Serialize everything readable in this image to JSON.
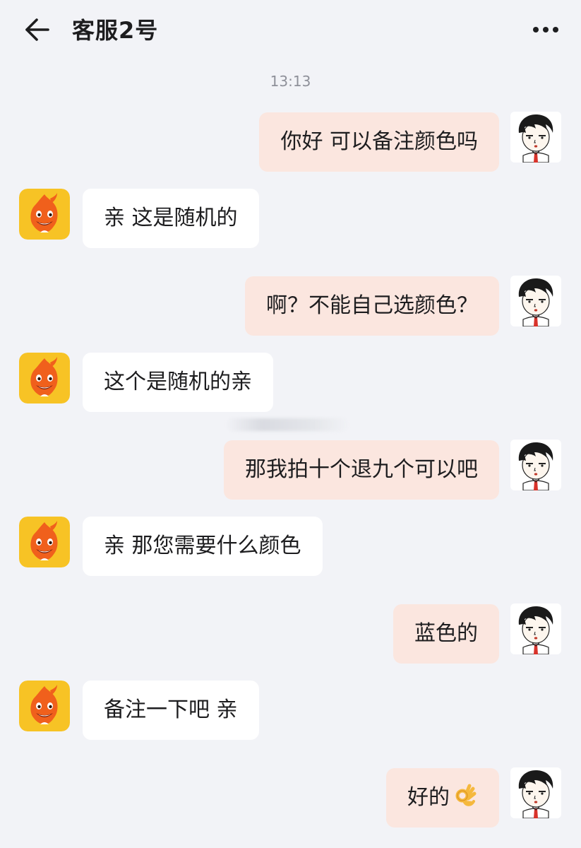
{
  "header": {
    "title": "客服2号",
    "back_icon": "back-arrow-icon",
    "more_icon": "more-dots-icon"
  },
  "chat": {
    "timestamp": "13:13",
    "messages": [
      {
        "sender": "user",
        "text": "你好 可以备注颜色吗"
      },
      {
        "sender": "agent",
        "text": "亲 这是随机的"
      },
      {
        "sender": "user",
        "text": "啊？不能自己选颜色？"
      },
      {
        "sender": "agent",
        "text": "这个是随机的亲"
      },
      {
        "sender": "user",
        "text": "那我拍十个退九个可以吧"
      },
      {
        "sender": "agent",
        "text": "亲 那您需要什么颜色"
      },
      {
        "sender": "user",
        "text": "蓝色的"
      },
      {
        "sender": "agent",
        "text": "备注一下吧 亲"
      },
      {
        "sender": "user",
        "text": "好的",
        "emoji": "ok-hand-emoji"
      }
    ]
  },
  "colors": {
    "background": "#f2f3f7",
    "agent_bubble": "#ffffff",
    "user_bubble": "#fbe6df",
    "timestamp_text": "#8e9099",
    "agent_avatar_bg": "#f7c325",
    "agent_avatar_figure": "#f0601c"
  }
}
